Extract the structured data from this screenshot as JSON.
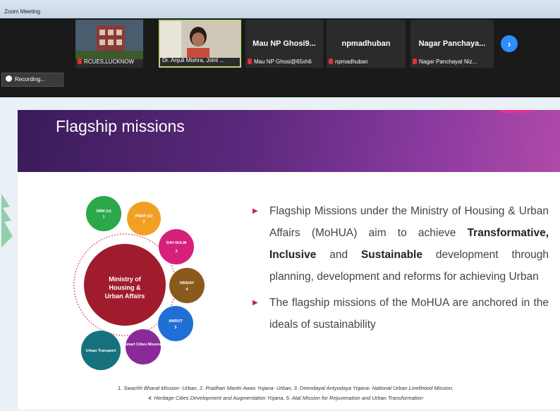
{
  "window": {
    "title": "Zoom Meeting"
  },
  "participants": [
    {
      "name": "RCUES,LUCKNOW",
      "bigname": ""
    },
    {
      "name": "Dr. Anjuli Mishra, Joint ...",
      "bigname": ""
    },
    {
      "name": "Mau NP Ghosi@65xh6",
      "bigname": "Mau NP Ghosi9..."
    },
    {
      "name": "npmadhuban",
      "bigname": "npmadhuban"
    },
    {
      "name": "Nagar Panchayat Niz...",
      "bigname": "Nagar Panchaya..."
    }
  ],
  "recording": {
    "label": "Recording..."
  },
  "slide": {
    "title": "Flagship missions",
    "center": "Ministry of Housing & Urban Affairs",
    "missions": [
      {
        "label": "SBM (U)",
        "num": "1",
        "color": "#2aa84a"
      },
      {
        "label": "PMAY (U)",
        "num": "2",
        "color": "#f2a024"
      },
      {
        "label": "DAY-NULM",
        "num": "3",
        "color": "#d6207a"
      },
      {
        "label": "HRIDAY",
        "num": "4",
        "color": "#8a5a1c"
      },
      {
        "label": "AMRUT",
        "num": "5",
        "color": "#1f6fd6"
      },
      {
        "label": "Smart Cities Mission",
        "num": "",
        "color": "#8a2a9a"
      },
      {
        "label": "Urban Transport",
        "num": "",
        "color": "#17727e"
      }
    ],
    "bullet1": {
      "pre": "Flagship Missions under the Ministry of Housing & Urban Affairs (MoHUA) aim to achieve ",
      "b1": "Transformative,",
      "b2": "Inclusive",
      "and": "and",
      "b3": "Sustainable",
      "post": " development through planning, development and reforms for achieving Urban"
    },
    "bullet2": "The flagship missions of the MoHUA are anchored in the ideals of sustainability",
    "footnote_line1": "1. Swachh Bharat Mission- Urban,   2. Pradhan Mantri Awas Yojana- Urban,   3. Deendayal Antyodaya Yojana- National Urban Livelihood Mission,",
    "footnote_line2": "4. Heritage Cities Development and Augmentation Yojana,   5. Atal Mission for Rejuvenation and Urban Transformation"
  }
}
